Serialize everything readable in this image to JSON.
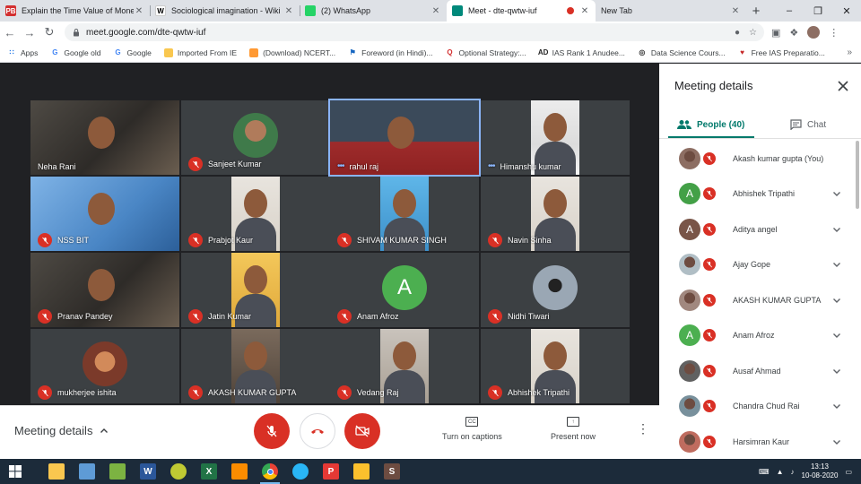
{
  "browser": {
    "tabs": [
      {
        "title": "Explain the Time Value of Mone",
        "favicon": "PB",
        "favicon_color": "#d32f2f"
      },
      {
        "title": "Sociological imagination - Wiki",
        "favicon": "W",
        "favicon_color": "#ffffff"
      },
      {
        "title": "(2) WhatsApp",
        "favicon": "",
        "favicon_color": "#25d366"
      },
      {
        "title": "Meet - dte-qwtw-iuf",
        "favicon": "",
        "favicon_color": "#00897b",
        "active": true,
        "recording": true
      },
      {
        "title": "New Tab",
        "favicon": "",
        "favicon_color": ""
      }
    ],
    "url": "meet.google.com/dte-qwtw-iuf",
    "bookmarks": [
      {
        "label": "Apps",
        "icon": "apps-grid-icon"
      },
      {
        "label": "Google old",
        "icon": "google-icon"
      },
      {
        "label": "Google",
        "icon": "google-icon"
      },
      {
        "label": "Imported From IE",
        "icon": "folder-icon"
      },
      {
        "label": "(Download) NCERT...",
        "icon": "india-flag-icon"
      },
      {
        "label": "Foreword (in Hindi)...",
        "icon": "bookmark-icon"
      },
      {
        "label": "Optional Strategy:...",
        "icon": "q-icon"
      },
      {
        "label": "IAS Rank 1 Anudee...",
        "icon": "ad-icon"
      },
      {
        "label": "Data Science Cours...",
        "icon": "globe-icon"
      },
      {
        "label": "Free IAS Preparatio...",
        "icon": "heart-icon"
      }
    ]
  },
  "meet": {
    "tiles": [
      {
        "name": "Neha Rani",
        "muted": false,
        "talking": false,
        "scene": "room-dark"
      },
      {
        "name": "Sanjeet Kumar",
        "muted": true,
        "talking": false,
        "scene": "avatar"
      },
      {
        "name": "rahul raj",
        "muted": false,
        "talking": true,
        "scene": "person-red"
      },
      {
        "name": "Himanshu kumar",
        "muted": false,
        "talking": true,
        "scene": "person-white"
      },
      {
        "name": "NSS BIT",
        "muted": true,
        "talking": false,
        "scene": "poster-blue"
      },
      {
        "name": "Prabjot Kaur",
        "muted": true,
        "talking": false,
        "scene": "person-light"
      },
      {
        "name": "SHIVAM KUMAR SINGH",
        "muted": true,
        "talking": false,
        "scene": "person-blue"
      },
      {
        "name": "Navin Sinha",
        "muted": true,
        "talking": false,
        "scene": "person-light"
      },
      {
        "name": "Pranav Pandey",
        "muted": true,
        "talking": false,
        "scene": "room-dark"
      },
      {
        "name": "Jatin Kumar",
        "muted": true,
        "talking": false,
        "scene": "person-yellow"
      },
      {
        "name": "Anam Afroz",
        "muted": true,
        "talking": false,
        "scene": "initial",
        "initial": "A"
      },
      {
        "name": "Nidhi Tiwari",
        "muted": true,
        "talking": false,
        "scene": "avatar-dark"
      },
      {
        "name": "mukherjee ishita",
        "muted": true,
        "talking": false,
        "scene": "avatar-warm"
      },
      {
        "name": "AKASH KUMAR GUPTA",
        "muted": true,
        "talking": false,
        "scene": "person-room"
      },
      {
        "name": "Vedang Raj",
        "muted": true,
        "talking": false,
        "scene": "person-wall"
      },
      {
        "name": "Abhishek Tripathi",
        "muted": true,
        "talking": false,
        "scene": "person-light"
      }
    ],
    "bottom": {
      "details_label": "Meeting details",
      "captions_label": "Turn on captions",
      "captions_icon_text": "CC",
      "present_label": "Present now"
    }
  },
  "panel": {
    "title": "Meeting details",
    "people_tab": "People (40)",
    "chat_tab": "Chat",
    "participants": [
      {
        "name": "Akash kumar gupta (You)",
        "avatar": "photo",
        "color": "#8d6e63"
      },
      {
        "name": "Abhishek Tripathi",
        "avatar": "A",
        "color": "#43a047"
      },
      {
        "name": "Aditya angel",
        "avatar": "A",
        "color": "#795548"
      },
      {
        "name": "Ajay Gope",
        "avatar": "photo",
        "color": "#b0bec5"
      },
      {
        "name": "AKASH KUMAR GUPTA",
        "avatar": "photo",
        "color": "#a1887f"
      },
      {
        "name": "Anam Afroz",
        "avatar": "A",
        "color": "#4caf50"
      },
      {
        "name": "Ausaf Ahmad",
        "avatar": "photo",
        "color": "#616161"
      },
      {
        "name": "Chandra Chud Rai",
        "avatar": "photo",
        "color": "#78909c"
      },
      {
        "name": "Harsimran Kaur",
        "avatar": "photo",
        "color": "#bf6c5f"
      }
    ]
  },
  "taskbar": {
    "apps": [
      {
        "name": "file-explorer-icon",
        "color": "#f9c74f",
        "text": ""
      },
      {
        "name": "notepad-icon",
        "color": "#5e9bd6",
        "text": ""
      },
      {
        "name": "colorful-grid-icon",
        "color": "#7cb342",
        "text": ""
      },
      {
        "name": "word-icon",
        "color": "#2b579a",
        "text": "W"
      },
      {
        "name": "green-circle-icon",
        "color": "#c0ca33",
        "text": ""
      },
      {
        "name": "excel-icon",
        "color": "#217346",
        "text": "X"
      },
      {
        "name": "xampp-icon",
        "color": "#fb8c00",
        "text": ""
      },
      {
        "name": "chrome-icon",
        "color": "#4285f4",
        "text": "",
        "active": true
      },
      {
        "name": "telegram-icon",
        "color": "#29b6f6",
        "text": ""
      },
      {
        "name": "p-app-icon",
        "color": "#e53935",
        "text": "P"
      },
      {
        "name": "book-icon",
        "color": "#fbc02d",
        "text": ""
      },
      {
        "name": "s-app-icon",
        "color": "#6d4c41",
        "text": "S"
      }
    ],
    "time": "13:13",
    "date": "10-08-2020"
  }
}
